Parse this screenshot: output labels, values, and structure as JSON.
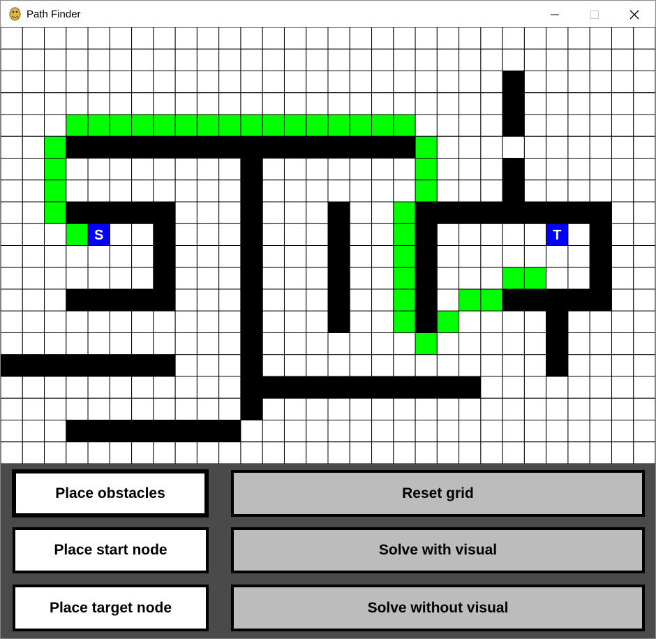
{
  "window": {
    "title": "Path Finder",
    "app_icon": "python-snake-icon",
    "controls": [
      "minimize-icon",
      "maximize-icon",
      "close-icon"
    ]
  },
  "colors": {
    "grid_line": "#000000",
    "empty": "#ffffff",
    "wall": "#000000",
    "path": "#00ff00",
    "node": "#0000ff",
    "panel": "#4a4a4a",
    "tool_button": "#ffffff",
    "action_button": "#bcbcbc"
  },
  "grid": {
    "cols": 30,
    "rows": 20,
    "start": {
      "row": 9,
      "col": 4,
      "label": "S"
    },
    "target": {
      "row": 9,
      "col": 25,
      "label": "T"
    },
    "walls": [
      [
        2,
        23
      ],
      [
        3,
        23
      ],
      [
        4,
        23
      ],
      [
        6,
        23
      ],
      [
        7,
        23
      ],
      [
        5,
        3
      ],
      [
        5,
        4
      ],
      [
        5,
        5
      ],
      [
        5,
        6
      ],
      [
        5,
        7
      ],
      [
        5,
        8
      ],
      [
        5,
        9
      ],
      [
        5,
        10
      ],
      [
        5,
        11
      ],
      [
        5,
        12
      ],
      [
        5,
        13
      ],
      [
        5,
        14
      ],
      [
        5,
        15
      ],
      [
        5,
        16
      ],
      [
        5,
        17
      ],
      [
        5,
        18
      ],
      [
        6,
        11
      ],
      [
        7,
        11
      ],
      [
        8,
        11
      ],
      [
        9,
        11
      ],
      [
        10,
        11
      ],
      [
        11,
        11
      ],
      [
        12,
        11
      ],
      [
        13,
        11
      ],
      [
        14,
        11
      ],
      [
        15,
        11
      ],
      [
        16,
        11
      ],
      [
        17,
        11
      ],
      [
        8,
        3
      ],
      [
        8,
        4
      ],
      [
        8,
        5
      ],
      [
        8,
        6
      ],
      [
        8,
        7
      ],
      [
        9,
        7
      ],
      [
        10,
        7
      ],
      [
        11,
        7
      ],
      [
        12,
        3
      ],
      [
        12,
        4
      ],
      [
        12,
        5
      ],
      [
        12,
        6
      ],
      [
        12,
        7
      ],
      [
        8,
        15
      ],
      [
        9,
        15
      ],
      [
        10,
        15
      ],
      [
        11,
        15
      ],
      [
        12,
        15
      ],
      [
        13,
        15
      ],
      [
        8,
        19
      ],
      [
        8,
        20
      ],
      [
        8,
        21
      ],
      [
        8,
        22
      ],
      [
        8,
        23
      ],
      [
        8,
        24
      ],
      [
        8,
        25
      ],
      [
        8,
        26
      ],
      [
        8,
        27
      ],
      [
        9,
        19
      ],
      [
        10,
        19
      ],
      [
        11,
        19
      ],
      [
        12,
        19
      ],
      [
        13,
        19
      ],
      [
        9,
        27
      ],
      [
        10,
        27
      ],
      [
        11,
        27
      ],
      [
        12,
        27
      ],
      [
        12,
        23
      ],
      [
        12,
        24
      ],
      [
        12,
        25
      ],
      [
        12,
        26
      ],
      [
        13,
        25
      ],
      [
        14,
        25
      ],
      [
        15,
        25
      ],
      [
        15,
        0
      ],
      [
        15,
        1
      ],
      [
        15,
        2
      ],
      [
        15,
        3
      ],
      [
        15,
        4
      ],
      [
        15,
        5
      ],
      [
        15,
        6
      ],
      [
        15,
        7
      ],
      [
        16,
        12
      ],
      [
        16,
        13
      ],
      [
        16,
        14
      ],
      [
        16,
        15
      ],
      [
        16,
        16
      ],
      [
        16,
        17
      ],
      [
        16,
        18
      ],
      [
        16,
        19
      ],
      [
        16,
        20
      ],
      [
        16,
        21
      ],
      [
        18,
        3
      ],
      [
        18,
        4
      ],
      [
        18,
        5
      ],
      [
        18,
        6
      ],
      [
        18,
        7
      ],
      [
        18,
        8
      ],
      [
        18,
        9
      ],
      [
        18,
        10
      ]
    ],
    "path": [
      [
        9,
        3
      ],
      [
        8,
        2
      ],
      [
        7,
        2
      ],
      [
        6,
        2
      ],
      [
        5,
        2
      ],
      [
        4,
        3
      ],
      [
        4,
        4
      ],
      [
        4,
        5
      ],
      [
        4,
        6
      ],
      [
        4,
        7
      ],
      [
        4,
        8
      ],
      [
        4,
        9
      ],
      [
        4,
        10
      ],
      [
        4,
        11
      ],
      [
        4,
        12
      ],
      [
        4,
        13
      ],
      [
        4,
        14
      ],
      [
        4,
        15
      ],
      [
        4,
        16
      ],
      [
        4,
        17
      ],
      [
        4,
        18
      ],
      [
        5,
        19
      ],
      [
        6,
        19
      ],
      [
        7,
        19
      ],
      [
        8,
        18
      ],
      [
        9,
        18
      ],
      [
        10,
        18
      ],
      [
        11,
        18
      ],
      [
        12,
        18
      ],
      [
        13,
        18
      ],
      [
        14,
        19
      ],
      [
        13,
        20
      ],
      [
        12,
        21
      ],
      [
        12,
        22
      ],
      [
        11,
        23
      ],
      [
        11,
        24
      ]
    ]
  },
  "buttons": {
    "place_obstacles": "Place obstacles",
    "place_start": "Place start node",
    "place_target": "Place target node",
    "reset_grid": "Reset grid",
    "solve_visual": "Solve with visual",
    "solve_no_visual": "Solve without visual"
  }
}
